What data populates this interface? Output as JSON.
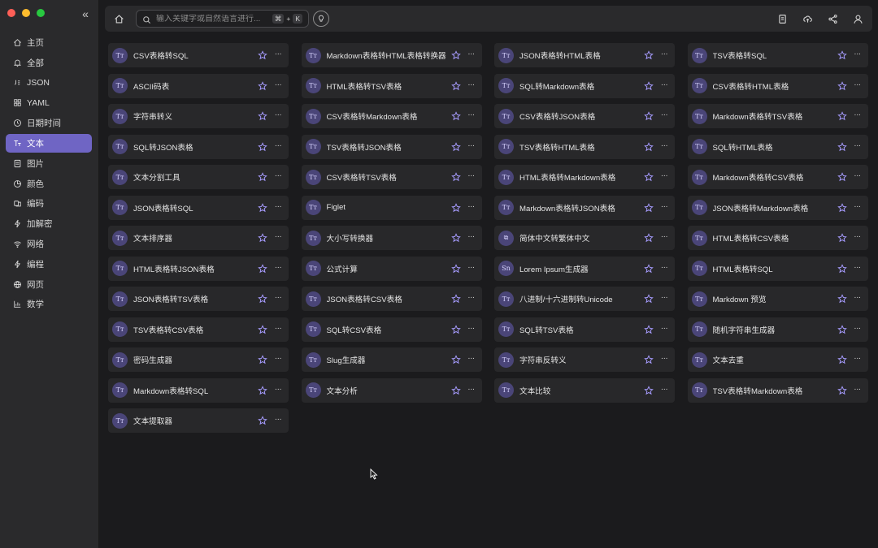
{
  "sidebar": {
    "items": [
      {
        "label": "主页",
        "icon": "home-icon"
      },
      {
        "label": "全部",
        "icon": "bell-icon"
      },
      {
        "label": "JSON",
        "icon": "json-icon"
      },
      {
        "label": "YAML",
        "icon": "grid-icon"
      },
      {
        "label": "日期时间",
        "icon": "clock-icon"
      },
      {
        "label": "文本",
        "icon": "text-icon"
      },
      {
        "label": "图片",
        "icon": "image-icon"
      },
      {
        "label": "颜色",
        "icon": "palette-icon"
      },
      {
        "label": "编码",
        "icon": "code-icon"
      },
      {
        "label": "加解密",
        "icon": "bolt-icon"
      },
      {
        "label": "网络",
        "icon": "wifi-icon"
      },
      {
        "label": "编程",
        "icon": "bolt-icon"
      },
      {
        "label": "网页",
        "icon": "globe-icon"
      },
      {
        "label": "数学",
        "icon": "chart-icon"
      }
    ],
    "active": "文本"
  },
  "search": {
    "placeholder": "输入关键字或自然语言进行...",
    "shortcut_mod": "⌘",
    "shortcut_plus": "+",
    "shortcut_key": "K"
  },
  "colors": {
    "accent": "#6f65c4",
    "star": "#a79cff",
    "card_bg": "#28282a"
  },
  "tools": [
    {
      "label": "CSV表格转SQL",
      "icon": "Tт"
    },
    {
      "label": "Markdown表格转HTML表格转换器",
      "icon": "Tт"
    },
    {
      "label": "JSON表格转HTML表格",
      "icon": "Tт"
    },
    {
      "label": "TSV表格转SQL",
      "icon": "Tт"
    },
    {
      "label": "ASCII码表",
      "icon": "Tт"
    },
    {
      "label": "HTML表格转TSV表格",
      "icon": "Tт"
    },
    {
      "label": "SQL转Markdown表格",
      "icon": "Tт"
    },
    {
      "label": "CSV表格转HTML表格",
      "icon": "Tт"
    },
    {
      "label": "字符串转义",
      "icon": "Tт"
    },
    {
      "label": "CSV表格转Markdown表格",
      "icon": "Tт"
    },
    {
      "label": "CSV表格转JSON表格",
      "icon": "Tт"
    },
    {
      "label": "Markdown表格转TSV表格",
      "icon": "Tт"
    },
    {
      "label": "SQL转JSON表格",
      "icon": "Tт"
    },
    {
      "label": "TSV表格转JSON表格",
      "icon": "Tт"
    },
    {
      "label": "TSV表格转HTML表格",
      "icon": "Tт"
    },
    {
      "label": "SQL转HTML表格",
      "icon": "Tт"
    },
    {
      "label": "文本分割工具",
      "icon": "Tт"
    },
    {
      "label": "CSV表格转TSV表格",
      "icon": "Tт"
    },
    {
      "label": "HTML表格转Markdown表格",
      "icon": "Tт"
    },
    {
      "label": "Markdown表格转CSV表格",
      "icon": "Tт"
    },
    {
      "label": "JSON表格转SQL",
      "icon": "Tт"
    },
    {
      "label": "Figlet",
      "icon": "Tт"
    },
    {
      "label": "Markdown表格转JSON表格",
      "icon": "Tт"
    },
    {
      "label": "JSON表格转Markdown表格",
      "icon": "Tт"
    },
    {
      "label": "文本排序器",
      "icon": "Tт"
    },
    {
      "label": "大小写转换器",
      "icon": "Tт"
    },
    {
      "label": "简体中文转繁体中文",
      "icon": "⧉"
    },
    {
      "label": "HTML表格转CSV表格",
      "icon": "Tт"
    },
    {
      "label": "HTML表格转JSON表格",
      "icon": "Tт"
    },
    {
      "label": "公式计算",
      "icon": "Tт"
    },
    {
      "label": "Lorem Ipsum生成器",
      "icon": "Sn"
    },
    {
      "label": "HTML表格转SQL",
      "icon": "Tт"
    },
    {
      "label": "JSON表格转TSV表格",
      "icon": "Tт"
    },
    {
      "label": "JSON表格转CSV表格",
      "icon": "Tт"
    },
    {
      "label": "八进制/十六进制转Unicode",
      "icon": "Tт"
    },
    {
      "label": "Markdown 预览",
      "icon": "Tт"
    },
    {
      "label": "TSV表格转CSV表格",
      "icon": "Tт"
    },
    {
      "label": "SQL转CSV表格",
      "icon": "Tт"
    },
    {
      "label": "SQL转TSV表格",
      "icon": "Tт"
    },
    {
      "label": "随机字符串生成器",
      "icon": "Tт"
    },
    {
      "label": "密码生成器",
      "icon": "Tт"
    },
    {
      "label": "Slug生成器",
      "icon": "Tт"
    },
    {
      "label": "字符串反转义",
      "icon": "Tт"
    },
    {
      "label": "文本去重",
      "icon": "Tт"
    },
    {
      "label": "Markdown表格转SQL",
      "icon": "Tт"
    },
    {
      "label": "文本分析",
      "icon": "Tт"
    },
    {
      "label": "文本比较",
      "icon": "Tт"
    },
    {
      "label": "TSV表格转Markdown表格",
      "icon": "Tт"
    },
    {
      "label": "文本提取器",
      "icon": "Tт"
    }
  ]
}
